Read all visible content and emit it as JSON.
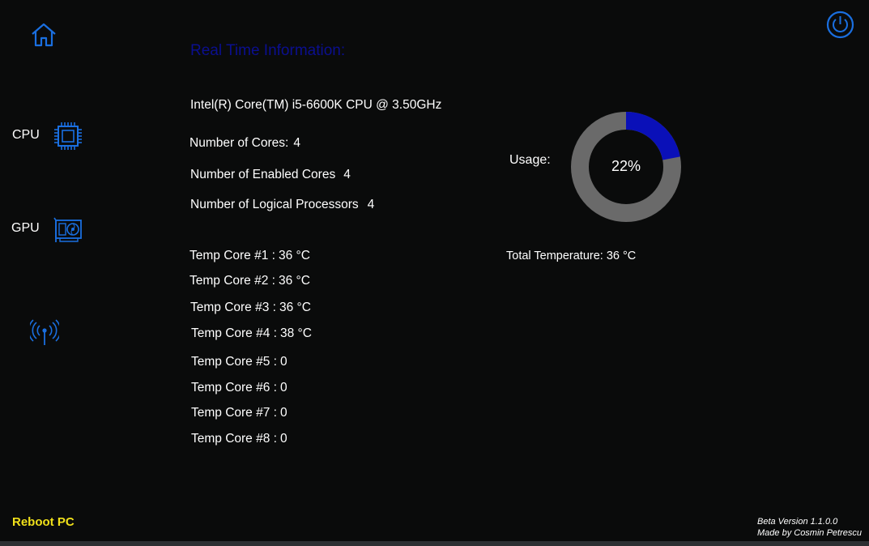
{
  "sidebar": {
    "home_icon": "home-icon",
    "items": [
      {
        "label": "CPU",
        "icon": "cpu-chip-icon"
      },
      {
        "label": "GPU",
        "icon": "graphics-card-icon"
      },
      {
        "label": "",
        "icon": "network-antenna-icon"
      }
    ],
    "reboot_label": "Reboot PC"
  },
  "header": {
    "power_icon": "power-icon"
  },
  "main": {
    "title": "Real Time Information:",
    "cpu_name": "Intel(R) Core(TM) i5-6600K CPU @ 3.50GHz",
    "info": [
      {
        "label": "Number of Cores:",
        "value": "4"
      },
      {
        "label": "Number of Enabled Cores",
        "value": "4"
      },
      {
        "label": "Number of Logical Processors",
        "value": "4"
      }
    ],
    "temps": [
      {
        "label": "Temp Core #1 :",
        "value": "36 °C"
      },
      {
        "label": "Temp Core #2 :",
        "value": "36 °C"
      },
      {
        "label": "Temp Core #3 :",
        "value": "36 °C"
      },
      {
        "label": "Temp Core #4 :",
        "value": "38 °C"
      },
      {
        "label": "Temp Core #5 :",
        "value": "0"
      },
      {
        "label": "Temp Core #6 :",
        "value": "0"
      },
      {
        "label": "Temp Core #7 :",
        "value": "0"
      },
      {
        "label": "Temp Core #8 :",
        "value": "0"
      }
    ],
    "usage": {
      "label": "Usage:",
      "value_text": "22%",
      "percent": 22,
      "fill_color": "#0a10b8",
      "track_color": "#6a6a6a"
    },
    "total_temp": {
      "label": "Total Temperature:",
      "value": "36 °C"
    }
  },
  "footer": {
    "version": "Beta Version 1.1.0.0",
    "author": "Made by Cosmin Petrescu"
  },
  "colors": {
    "background": "#0a0b0b",
    "icon_blue": "#1a6fe0",
    "title_blue": "#0b0f8f",
    "reboot_yellow": "#f0e01a"
  }
}
